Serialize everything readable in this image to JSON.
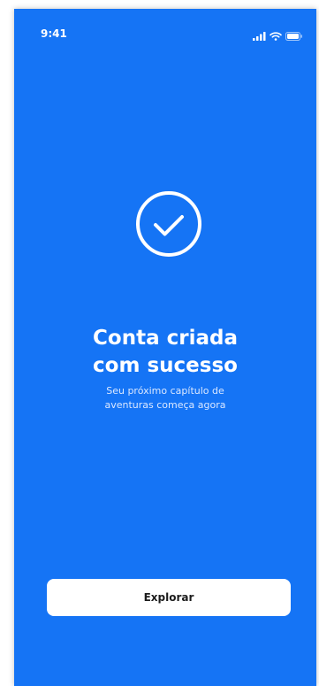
{
  "status_bar": {
    "time": "9:41",
    "icons": [
      "signal-icon",
      "wifi-icon",
      "battery-icon"
    ]
  },
  "success": {
    "icon": "check-circle-icon",
    "title_line1": "Conta criada",
    "title_line2": "com sucesso",
    "subtitle_line1": "Seu próximo capítulo de",
    "subtitle_line2": "aventuras começa agora"
  },
  "actions": {
    "explore_label": "Explorar"
  },
  "colors": {
    "background": "#1574f5",
    "button": "#ffffff",
    "text": "#ffffff"
  }
}
